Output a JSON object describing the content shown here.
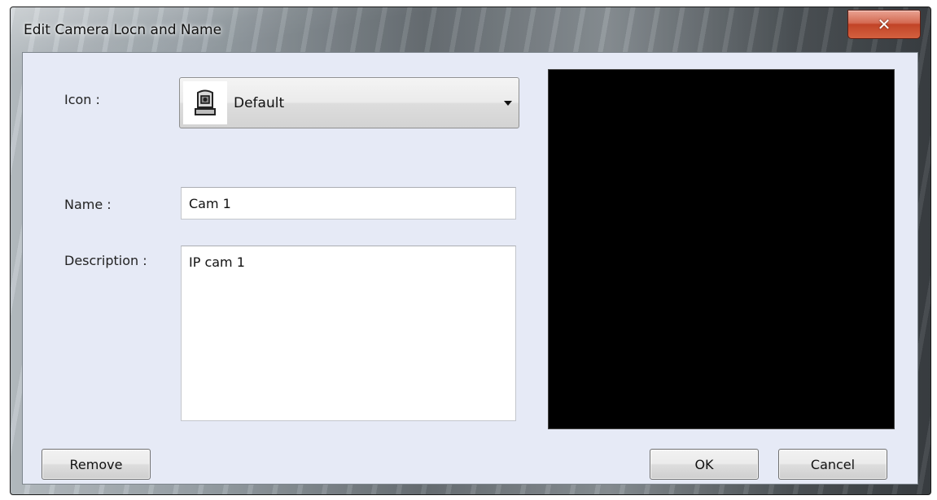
{
  "window": {
    "title": "Edit Camera Locn and Name",
    "close_symbol": "✕"
  },
  "form": {
    "icon_label": "Icon :",
    "icon_select": {
      "value": "Default",
      "icon": "camera-icon"
    },
    "name_label": "Name :",
    "name_value": "Cam 1",
    "description_label": "Description :",
    "description_value": "IP cam 1"
  },
  "preview": {
    "background": "#000000"
  },
  "buttons": {
    "remove": "Remove",
    "ok": "OK",
    "cancel": "Cancel"
  }
}
